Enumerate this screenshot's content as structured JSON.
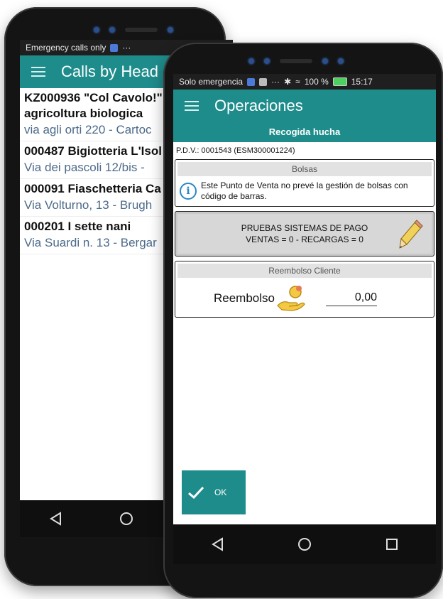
{
  "back_phone": {
    "status_text": "Emergency calls only",
    "status_extra": "···",
    "title": "Calls by Head",
    "calls": [
      {
        "title": "KZ000936 \"Col Cavolo!\" -",
        "title2": "agricoltura biologica",
        "sub": "via agli orti 220 - Cartoc"
      },
      {
        "title": "000487 Bigiotteria L'Isol",
        "sub": "Via dei pascoli 12/bis -"
      },
      {
        "title": "000091 Fiaschetteria Ca",
        "sub": "Via Volturno, 13 - Brugh"
      },
      {
        "title": "000201 I sette nani",
        "sub": "Via Suardi n. 13 - Bergar"
      }
    ]
  },
  "front_phone": {
    "status_left": "Solo emergencia",
    "status_extra": "···",
    "battery_percent": "100 %",
    "time": "15:17",
    "title": "Operaciones",
    "section_title": "Recogida hucha",
    "pdv": "P.D.V.: 0001543 (ESM300001224)",
    "bags": {
      "header": "Bolsas",
      "info": "Este Punto de Venta no prevé la gestión de bolsas con código de barras."
    },
    "payment": {
      "line1": "PRUEBAS SISTEMAS DE PAGO",
      "line2": "VENTAS = 0 - RECARGAS = 0"
    },
    "refund": {
      "header": "Reembolso Cliente",
      "label": "Reembolso",
      "value": "0,00"
    },
    "ok_label": "OK"
  },
  "colors": {
    "teal": "#1f8c8c",
    "link_blue": "#4c6a8a",
    "info_blue": "#2b86c5"
  },
  "icons": [
    "menu-icon",
    "info-icon",
    "pencil-icon",
    "coin-hand-icon",
    "check-icon",
    "back-icon",
    "home-icon",
    "recents-icon"
  ]
}
